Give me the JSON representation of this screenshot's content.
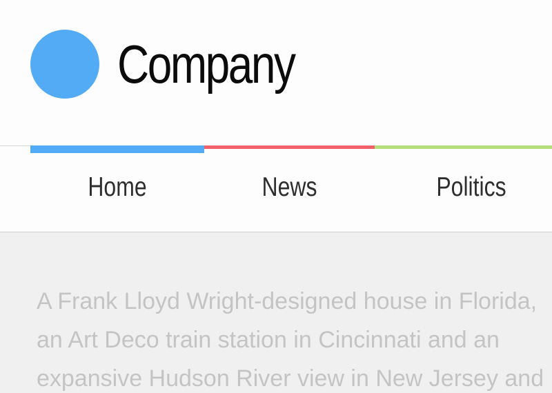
{
  "header": {
    "brand_name": "Company",
    "logo_color": "#53aaf5"
  },
  "nav": {
    "items": [
      {
        "label": "Home",
        "color": "#53aaf5",
        "active": true
      },
      {
        "label": "News",
        "color": "#f0616b",
        "active": false
      },
      {
        "label": "Politics",
        "color": "#b4df7a",
        "active": false
      }
    ]
  },
  "article": {
    "lines": [
      "A Frank Lloyd Wright-designed house in Florida,",
      "an Art Deco train station in Cincinnati and an",
      "expansive Hudson River view in New Jersey and"
    ]
  }
}
